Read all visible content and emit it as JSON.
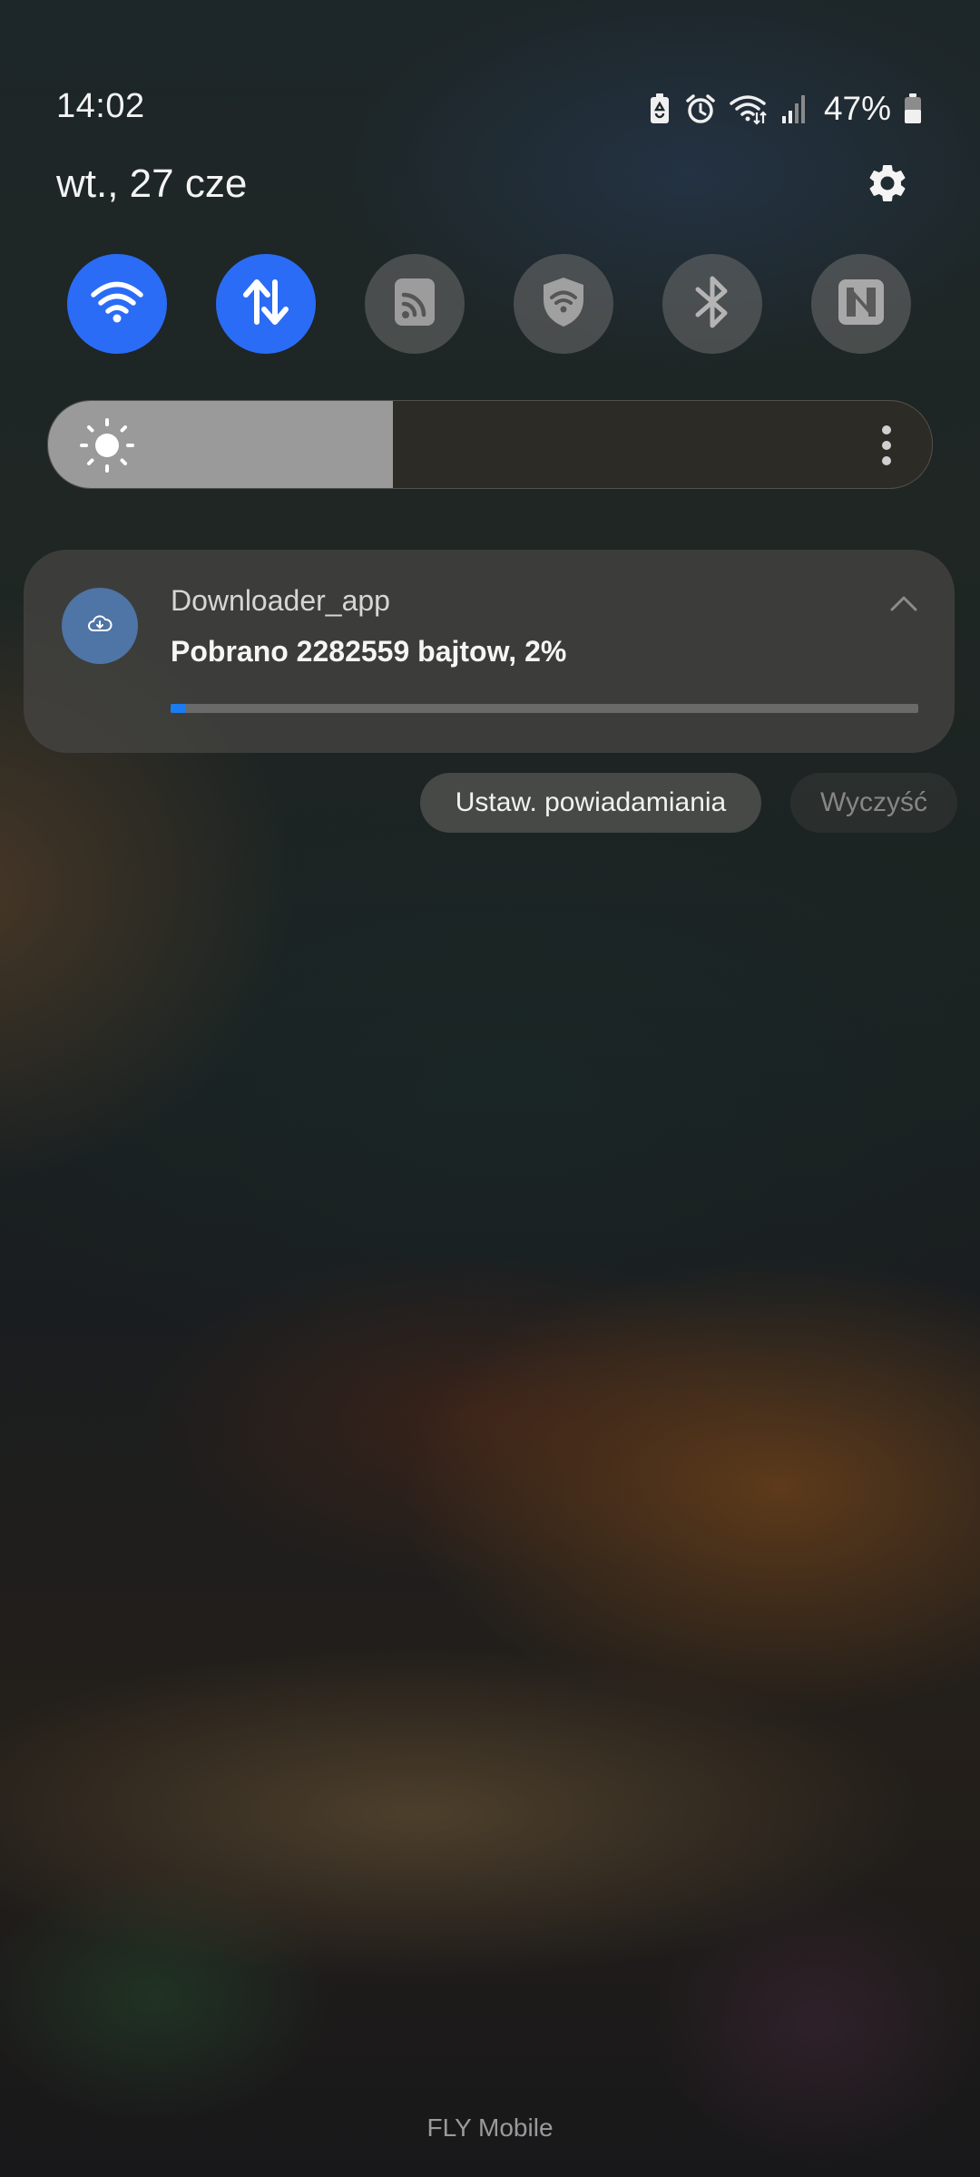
{
  "status_bar": {
    "time": "14:02",
    "battery_percent": "47%",
    "icons": [
      "battery-saver-icon",
      "alarm-icon",
      "wifi-data-icon",
      "cell-signal-icon",
      "battery-icon"
    ]
  },
  "header": {
    "date": "wt., 27 cze",
    "settings_icon": "gear-icon"
  },
  "quick_tiles": [
    {
      "name": "wifi",
      "icon": "wifi-icon",
      "active": true
    },
    {
      "name": "mobile-data",
      "icon": "data-arrows-icon",
      "active": true
    },
    {
      "name": "rss",
      "icon": "rss-icon",
      "active": false
    },
    {
      "name": "secure-wifi",
      "icon": "shield-wifi-icon",
      "active": false
    },
    {
      "name": "bluetooth",
      "icon": "bluetooth-icon",
      "active": false
    },
    {
      "name": "nfc",
      "icon": "nfc-icon",
      "active": false
    }
  ],
  "brightness": {
    "level": 0.39,
    "icon": "sun-icon"
  },
  "notification": {
    "app_name": "Downloader_app",
    "text": "Pobrano 2282559 bajtow, 2%",
    "progress": 0.02,
    "app_icon": "cloud-download-icon"
  },
  "actions": {
    "notification_settings": "Ustaw. powiadamiania",
    "clear": "Wyczyść"
  },
  "carrier": "FLY Mobile",
  "colors": {
    "accent": "#2b6cf6",
    "progress": "#1a7cf0",
    "app_icon_bg": "#4f74a6"
  }
}
